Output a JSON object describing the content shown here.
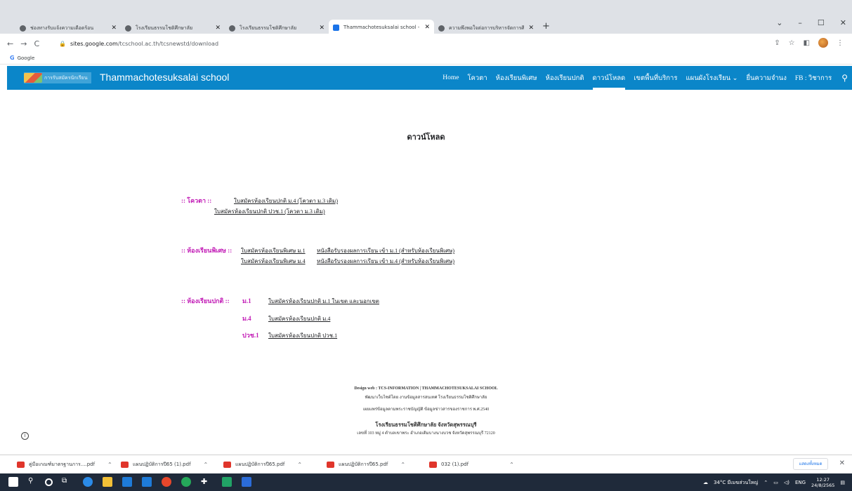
{
  "browser": {
    "tabs": [
      {
        "title": "ช่องทางรับแจ้งความเดือดร้อน",
        "active": false
      },
      {
        "title": "โรงเรียนธรรมโชติศึกษาลัย",
        "active": false
      },
      {
        "title": "โรงเรียนธรรมโชติศึกษาลัย",
        "active": false
      },
      {
        "title": "Thammachotesuksalai school - ดาวน์โหลด",
        "active": true
      },
      {
        "title": "ความพึงพอใจต่อการบริหารจัดการศึกษา",
        "active": false
      }
    ],
    "new_tab": "+",
    "window_controls": {
      "minimize": "–",
      "restore": "☐",
      "close": "✕",
      "chevron": "⌄"
    },
    "url_host": "sites.google.com",
    "url_path": "/tcschool.ac.th/tcsnewstd/download",
    "bookmark": "Google",
    "nav": {
      "back": "←",
      "forward": "→",
      "reload": "C"
    }
  },
  "site": {
    "logo_text": "การรับสมัครนักเรียน",
    "title": "Thammachotesuksalai school",
    "nav_items": [
      {
        "label": "Home",
        "current": false
      },
      {
        "label": "โควตา",
        "current": false
      },
      {
        "label": "ห้องเรียนพิเศษ",
        "current": false
      },
      {
        "label": "ห้องเรียนปกติ",
        "current": false
      },
      {
        "label": "ดาวน์โหลด",
        "current": true
      },
      {
        "label": "เขตพื้นที่บริการ",
        "current": false
      },
      {
        "label": "แผนผังโรงเรียน ⌄",
        "current": false
      },
      {
        "label": "ยื่นความจำนง",
        "current": false
      },
      {
        "label": "FB : วิชาการ",
        "current": false
      }
    ]
  },
  "content": {
    "heading": "ดาวน์โหลด",
    "quota": {
      "label": ":: โควตา ::",
      "links": [
        "ใบสมัครห้องเรียนปกติ ม.4 (โควตา ม.3 เดิม)",
        "ใบสมัครห้องเรียนปกติ ปวช.1 (โควตา ม.3 เดิม)"
      ]
    },
    "special": {
      "label": ":: ห้องเรียนพิเศษ ::",
      "row1": [
        "ใบสมัครห้องเรียนพิเศษ ม.1",
        "หนังสือรับรองผลการเรียน เข้า ม.1 (สำหรับห้องเรียนพิเศษ)"
      ],
      "row2": [
        "ใบสมัครห้องเรียนพิเศษ ม.4",
        "หนังสือรับรองผลการเรียน เข้า ม.4 (สำหรับห้องเรียนพิเศษ)"
      ]
    },
    "normal": {
      "label": ":: ห้องเรียนปกติ ::",
      "rows": [
        {
          "grade": "ม.1",
          "link": "ใบสมัครห้องเรียนปกติ ม.1 ในเขต และนอกเขต"
        },
        {
          "grade": "ม.4",
          "link": "ใบสมัครห้องเรียนปกติ ม.4"
        },
        {
          "grade": "ปวช.1",
          "link": "ใบสมัครห้องเรียนปกติ ปวช.1"
        }
      ]
    }
  },
  "footer": {
    "line1": "Design web : TCS-INFORMATION | THAMMACHOTESUKSALAI SCHOOL",
    "line2": "พัฒนาเว็บไซต์โดย งานข้อมูลสารสนเทศ โรงเรียนธรรมโชติศึกษาลัย",
    "line3": "เผยแพร่ข้อมูลตามพระราชบัญญัติ ข้อมูลข่าวสารของราชการ พ.ศ.2540",
    "line4": "โรงเรียนธรรมโชติศึกษาลัย จังหวัดสุพรรณบุรี",
    "line5": "เลขที่ 103 หมู่ 4 ตำบลเขาพระ อำเภอเดิมบางนางบวช จังหวัดสุพรรณบุรี 72120"
  },
  "downloads": {
    "items": [
      "คู่มือเกณฑ์มาตรฐานการ....pdf",
      "แผนปฏิบัติการปี65 (1).pdf",
      "แผนปฏิบัติการปี65.pdf",
      "แผนปฏิบัติการปี65.pdf",
      "032 (1).pdf"
    ],
    "show_all": "แสดงทั้งหมด",
    "close": "✕"
  },
  "taskbar": {
    "weather": "34°C มีเมฆส่วนใหญ่",
    "lang": "ENG",
    "time": "12:27",
    "date": "24/8/2565",
    "icon_colors": [
      "#ffffff",
      "#2b8be8",
      "#f2c037",
      "#1e7bd8",
      "#1e7bd8",
      "#e7472b",
      "#25a85a",
      "#ffffff",
      "#21a366",
      "#2b6cd8"
    ]
  }
}
